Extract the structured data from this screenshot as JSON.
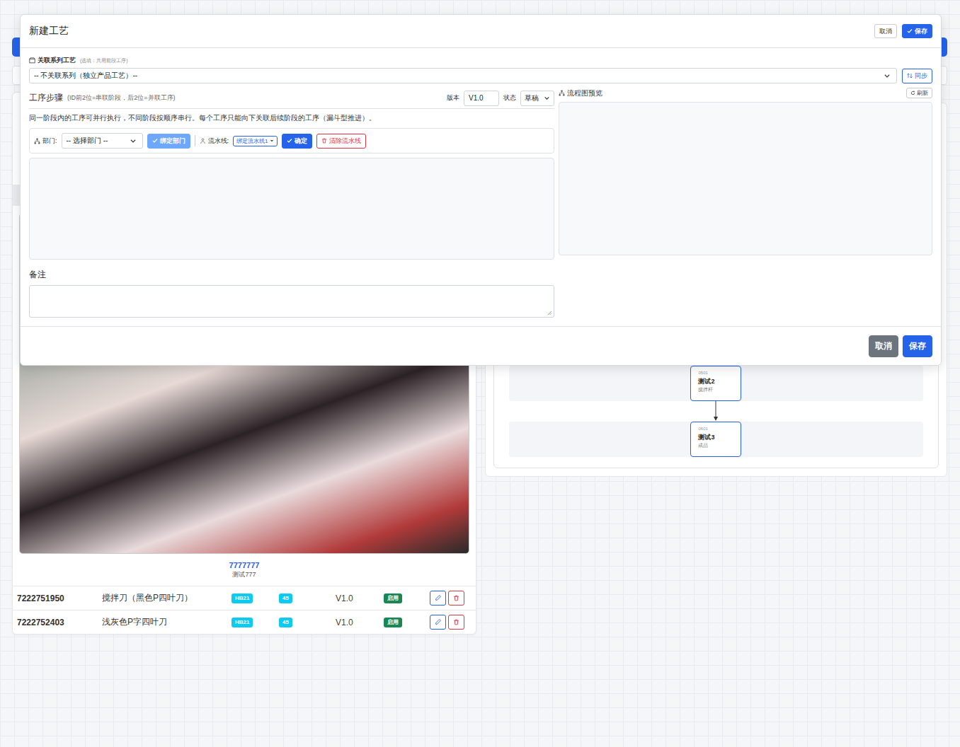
{
  "modal": {
    "title": "新建工艺",
    "header_buttons": [
      {
        "label": "取消",
        "kind": "secondary"
      },
      {
        "label": "保存",
        "kind": "primary"
      }
    ],
    "series": {
      "label": "关联系列工艺",
      "hint": "(选填：共用前段工序)",
      "value": "-- 不关联系列（独立产品工艺）--",
      "sync_button": "同步"
    },
    "steps": {
      "title": "工序步骤",
      "hint": "(ID前2位=串联阶段，后2位=并联工序)",
      "version_label": "版本",
      "version": "V1.0",
      "status_label": "状态",
      "status": "草稿",
      "description": "同一阶段内的工序可并行执行，不同阶段按顺序串行。每个工序只能向下关联后续阶段的工序（漏斗型推进）。",
      "department_label": "部门:",
      "department_placeholder": "-- 选择部门 --",
      "bind_department": "绑定部门",
      "bind_department_disabled": true,
      "line_label": "流水线:",
      "line_value": "绑定流水线1",
      "confirm": "确定",
      "clear_line": "清除流水线"
    },
    "remark_label": "备注",
    "preview": {
      "title": "流程图预览",
      "refresh": "刷新"
    },
    "footer_buttons": [
      {
        "label": "取消",
        "kind": "dark"
      },
      {
        "label": "保存",
        "kind": "primary"
      }
    ]
  },
  "background": {
    "product": {
      "code": "7777777",
      "name": "测试777"
    },
    "rows": [
      {
        "code": "7222751950",
        "name": "搅拌刀（黑色P四叶刀）",
        "tag1": "HB21",
        "tag2": "45",
        "version": "V1.0",
        "status": "启用",
        "status_color": "#198754"
      },
      {
        "code": "7222752403",
        "name": "浅灰色P字四叶刀",
        "tag1": "HB21",
        "tag2": "45",
        "version": "V1.0",
        "status": "启用",
        "status_color": "#198754"
      }
    ],
    "flow": {
      "nodes": [
        {
          "id": "0501",
          "name": "测试2",
          "sub": "搅拌杆"
        },
        {
          "id": "0601",
          "name": "测试3",
          "sub": "成品"
        }
      ]
    }
  }
}
